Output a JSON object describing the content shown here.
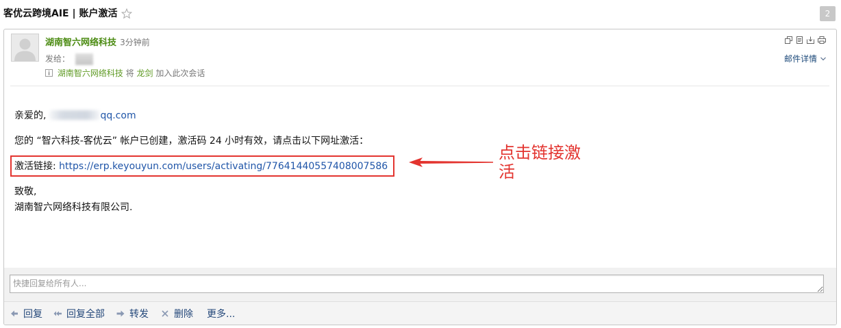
{
  "colors": {
    "sender_green": "#4b8b12",
    "notice_green": "#5f9a24",
    "link_blue": "#1f55a8",
    "nav_blue": "#24487a",
    "annotation_red": "#e3342f",
    "badge_gray": "#c8c8c8"
  },
  "header": {
    "subject": "客优云跨境AIE | 账户激活",
    "star_icon": "star-outline-icon",
    "conversation_count": "2"
  },
  "message": {
    "avatar_icon": "default-avatar-icon",
    "sender_name": "湖南智六网络科技",
    "sent_time": "3分钟前",
    "to_label": "发给：",
    "notice": {
      "icon": "info-icon",
      "actor": "湖南智六网络科技",
      "verb": "将",
      "person": "龙剑",
      "suffix": "加入此次会话"
    },
    "toolbar": {
      "icons": [
        "new-window-icon",
        "plain-text-icon",
        "download-icon",
        "print-icon"
      ],
      "details_label": "邮件详情",
      "details_icon": "chevron-down-icon"
    },
    "body": {
      "greeting": "亲爱的,",
      "greeting_domain": "qq.com",
      "intro": "您的 “智六科技-客优云” 帐户已创建，激活码 24 小时有效，请点击以下网址激活：",
      "activation_label": "激活链接:",
      "activation_url": "https://erp.keyouyun.com/users/activating/77641440557408007586",
      "closing": "致敬,",
      "signature": "湖南智六网络科技有限公司."
    }
  },
  "annotation": {
    "text": "点击链接激活",
    "arrow_icon": "arrow-left-icon"
  },
  "quick_reply": {
    "placeholder": "快捷回复给所有人..."
  },
  "actions": [
    {
      "label": "回复",
      "icon": "reply-icon"
    },
    {
      "label": "回复全部",
      "icon": "reply-all-icon"
    },
    {
      "label": "转发",
      "icon": "forward-icon"
    },
    {
      "label": "删除",
      "icon": "delete-icon"
    },
    {
      "label": "更多...",
      "icon": ""
    }
  ]
}
